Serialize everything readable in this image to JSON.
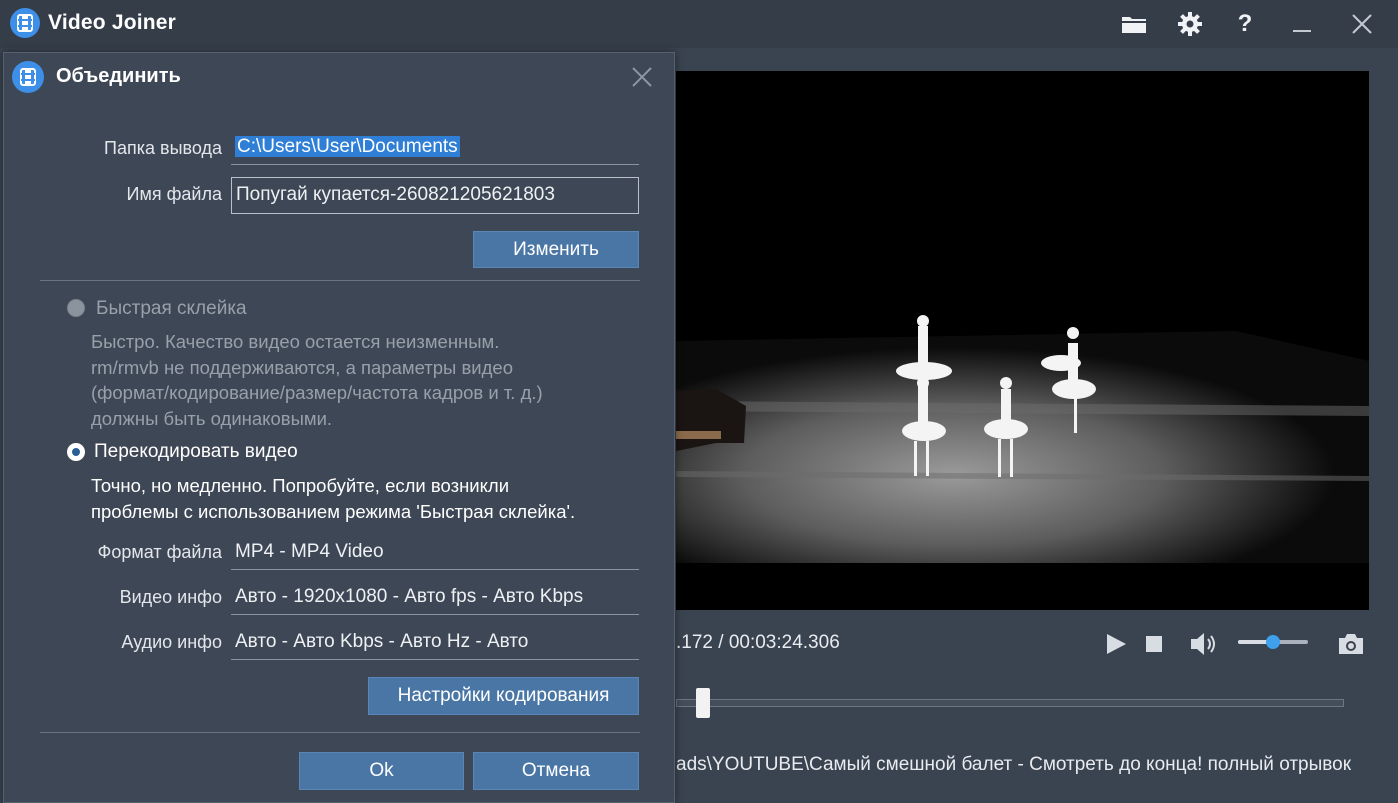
{
  "app": {
    "title": "Video Joiner"
  },
  "titlebar": {
    "icons": [
      "folder-icon",
      "gear-icon",
      "help-icon",
      "minimize-icon",
      "close-icon"
    ],
    "help_glyph": "?"
  },
  "player": {
    "time": ".172 / 00:03:24.306",
    "volume_level": 0.5,
    "seek_position": 0.04,
    "file_path": "ads\\YOUTUBE\\Самый смешной балет - Смотреть до конца! полный отрывок"
  },
  "dialog": {
    "title": "Объединить",
    "output_folder_label": "Папка вывода",
    "output_folder_value": "C:\\Users\\User\\Documents",
    "file_name_label": "Имя файла",
    "file_name_value": "Попугай купается-260821205621803",
    "change_button": "Изменить",
    "fast_join": {
      "label": "Быстрая склейка",
      "selected": false,
      "desc": [
        "Быстро. Качество видео остается неизменным.",
        "rm/rmvb не поддерживаются, а параметры видео",
        "(формат/кодирование/размер/частота кадров и т. д.)",
        "должны быть одинаковыми."
      ]
    },
    "reencode": {
      "label": "Перекодировать видео",
      "selected": true,
      "desc": [
        "Точно, но медленно. Попробуйте, если возникли",
        "проблемы с использованием режима 'Быстрая склейка'."
      ]
    },
    "format_label": "Формат файла",
    "format_value": "MP4 - MP4 Video",
    "video_info_label": "Видео инфо",
    "video_info_value": "Авто - 1920x1080 - Авто fps - Авто Kbps",
    "audio_info_label": "Аудио инфо",
    "audio_info_value": "Авто - Авто Kbps - Авто Hz - Авто",
    "encode_settings_button": "Настройки кодирования",
    "ok_button": "Ok",
    "cancel_button": "Отмена"
  },
  "colors": {
    "accent": "#3d8fe8",
    "button": "#4a76a6",
    "background": "#3a4350",
    "dialog_bg": "#3e4755"
  }
}
